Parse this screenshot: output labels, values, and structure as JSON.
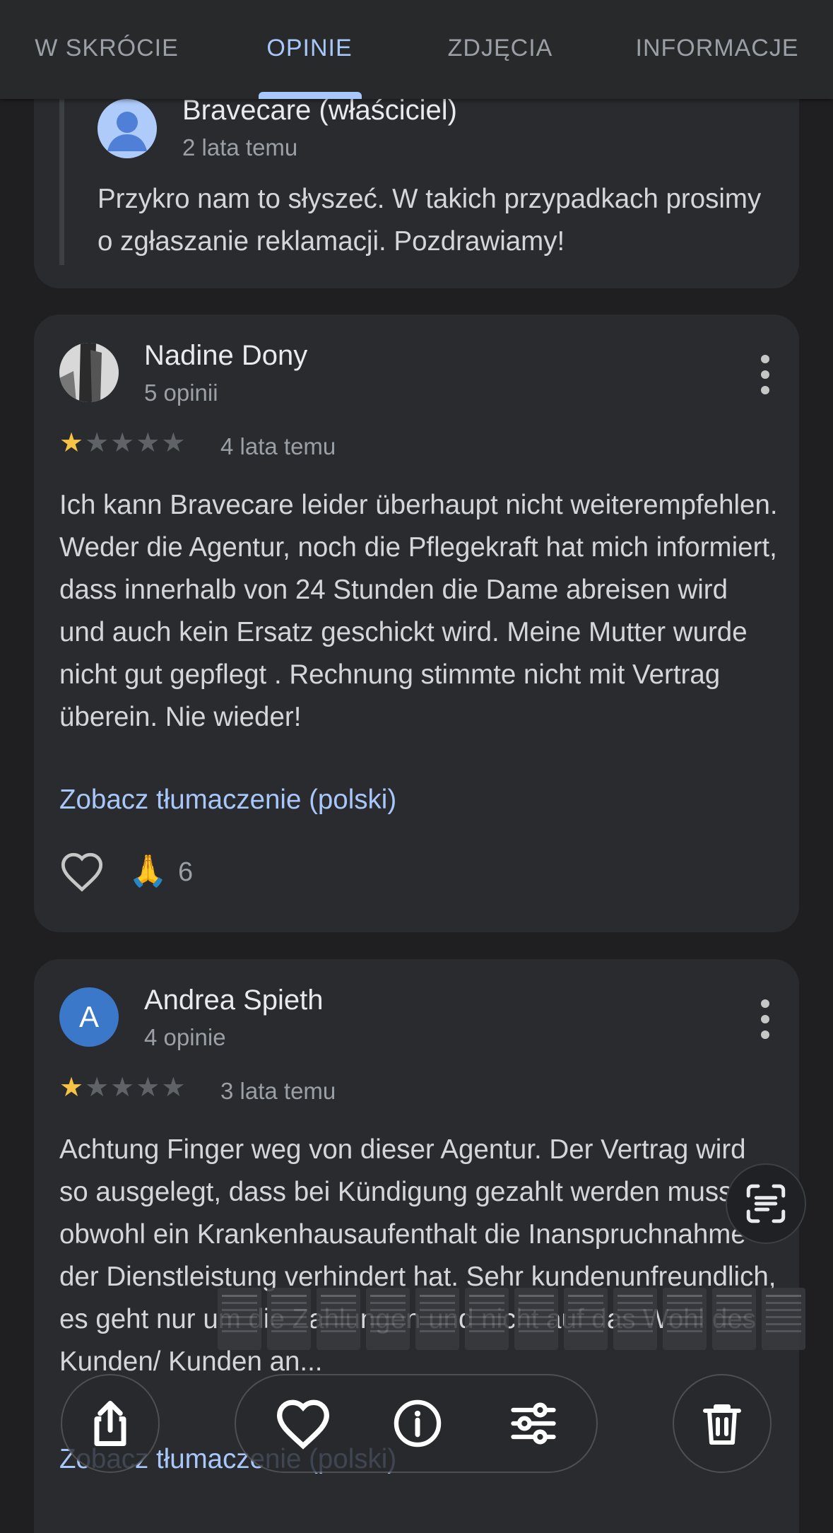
{
  "tabs": [
    {
      "label": "W SKRÓCIE",
      "active": false
    },
    {
      "label": "OPINIE",
      "active": true
    },
    {
      "label": "ZDJĘCIA",
      "active": false
    },
    {
      "label": "INFORMACJE",
      "active": false
    }
  ],
  "owner_reply": {
    "name": "Bravecare (właściciel)",
    "time": "2 lata temu",
    "text": "Przykro nam to słyszeć. W takich przypadkach prosimy o zgłaszanie reklamacji. Pozdrawiamy!"
  },
  "reviews": [
    {
      "author": "Nadine Dony",
      "review_count": "5 opinii",
      "rating": 1,
      "max_rating": 5,
      "time": "4 lata temu",
      "text": "Ich kann Bravecare leider überhaupt nicht weiterempfehlen. Weder die Agentur, noch die Pflegekraft hat mich informiert, dass innerhalb von 24 Stunden die Dame abreisen wird und auch kein Ersatz geschickt wird. Meine Mutter wurde nicht gut gepflegt . Rechnung stimmte nicht mit Vertrag überein. Nie wieder!",
      "translate_link": "Zobacz tłumaczenie (polski)",
      "reaction_emoji": "🙏",
      "reaction_count": "6"
    },
    {
      "author": "Andrea Spieth",
      "avatar_letter": "A",
      "review_count": "4 opinie",
      "rating": 1,
      "max_rating": 5,
      "time": "3 lata temu",
      "text": "Achtung Finger weg von dieser Agentur. Der Vertrag wird so ausgelegt, dass bei Kündigung gezahlt werden muss, obwohl ein Krankenhausaufenthalt die Inanspruchnahme der Dienstleistung verhindert hat. Sehr kundenunfreundlich, es geht nur um die Zahlungen und nicht auf das Wohl des Kunden/ Kunden an...",
      "translate_link": "Zobacz tłumaczenie (polski)"
    }
  ],
  "colors": {
    "accent": "#a8c7fa",
    "star_filled": "#f6c344",
    "star_empty": "#5f6368",
    "avatar_blue": "#3b78c9"
  },
  "icons": {
    "owner_avatar": "person-avatar-icon",
    "more": "more-vert-icon",
    "like": "heart-outline-icon",
    "lens": "text-scan-icon",
    "share": "share-icon",
    "favorite": "heart-icon",
    "info": "info-icon",
    "adjust": "sliders-icon",
    "delete": "trash-icon"
  }
}
